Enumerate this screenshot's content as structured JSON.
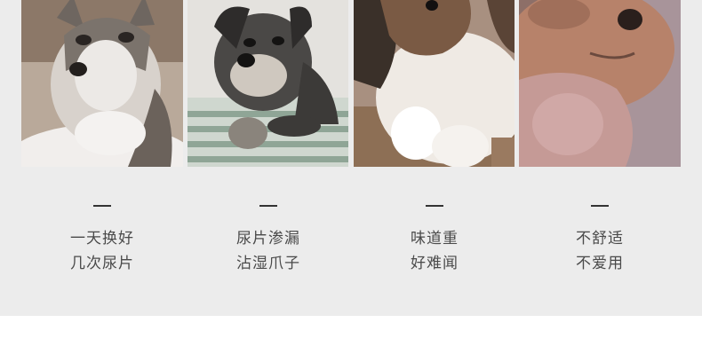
{
  "items": [
    {
      "image": "husky-puppy-photo",
      "lines": [
        "一天换好",
        "几次尿片"
      ]
    },
    {
      "image": "schnauzer-photo",
      "lines": [
        "尿片渗漏",
        "沾湿爪子"
      ]
    },
    {
      "image": "shih-tzu-puppy-photo",
      "lines": [
        "味道重",
        "好难闻"
      ]
    },
    {
      "image": "brown-puppy-closeup-photo",
      "lines": [
        "不舒适",
        "不爱用"
      ]
    }
  ],
  "colors": {
    "panel_bg": "#ececec",
    "text": "#4a4a4a",
    "dash": "#333333"
  }
}
